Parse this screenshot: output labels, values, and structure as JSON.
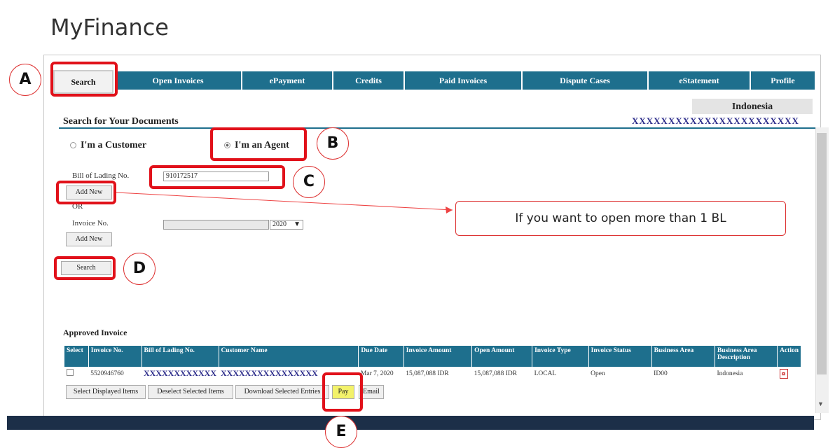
{
  "app": {
    "title": "MyFinance"
  },
  "nav": {
    "tabs": [
      {
        "label": "Search"
      },
      {
        "label": "Open Invoices"
      },
      {
        "label": "ePayment"
      },
      {
        "label": "Credits"
      },
      {
        "label": "Paid Invoices"
      },
      {
        "label": "Dispute Cases"
      },
      {
        "label": "eStatement"
      },
      {
        "label": "Profile"
      }
    ]
  },
  "header": {
    "country": "Indonesia",
    "agent_info": "XXXXXXXXXXXXXXXXXXXXXXX"
  },
  "search": {
    "title": "Search for Your Documents",
    "customer_label": "I'm a Customer",
    "agent_label": "I'm an Agent",
    "selected_role": "agent",
    "bl_label": "Bill of Lading No.",
    "bl_value": "910172517",
    "add_new_label": "Add New",
    "or_label": "OR",
    "invoice_label": "Invoice No.",
    "invoice_value": "",
    "year_value": "2020",
    "add_new_label_2": "Add New",
    "search_button": "Search"
  },
  "invoices": {
    "title": "Approved Invoice",
    "columns": [
      "Select",
      "Invoice No.",
      "Bill of Lading No.",
      "Customer Name",
      "Due Date",
      "Invoice Amount",
      "Open Amount",
      "Invoice Type",
      "Invoice Status",
      "Business Area",
      "Business Area Description",
      "Action"
    ],
    "rows": [
      {
        "invoice_no": "5520946760",
        "bl_no": "XXXXXXXXXXXX",
        "customer": "XXXXXXXXXXXXXXXX",
        "due_date": "Mar 7, 2020",
        "invoice_amount": "15,087,088 IDR",
        "open_amount": "15,087,088 IDR",
        "invoice_type": "LOCAL",
        "status": "Open",
        "business_area": "ID00",
        "business_area_desc": "Indonesia"
      }
    ],
    "actions": {
      "select_displayed": "Select Displayed Items",
      "deselect_selected": "Deselect Selected Items",
      "download_selected": "Download Selected Entries",
      "pay": "Pay",
      "email": "Email"
    }
  },
  "annotations": {
    "a": "A",
    "b": "B",
    "c": "C",
    "d": "D",
    "e": "E",
    "tooltip": "If you want to open more than 1 BL"
  },
  "colors": {
    "nav": "#1e6f8d",
    "highlight": "#e1111a",
    "footer": "#1c2f48",
    "pay_button": "#f3f26a"
  }
}
